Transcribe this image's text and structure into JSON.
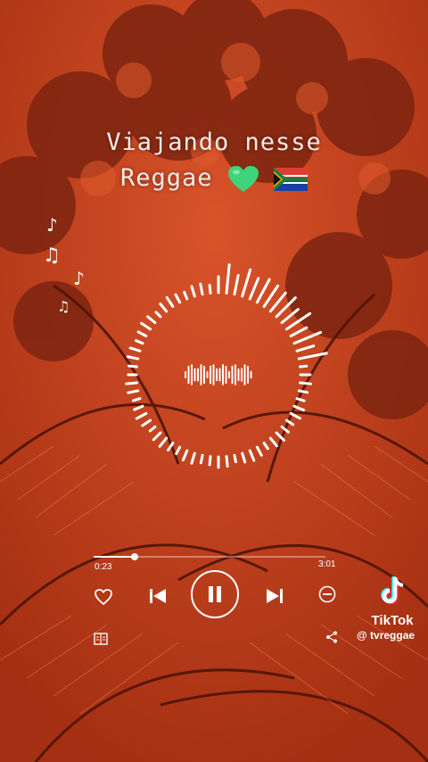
{
  "caption": {
    "line1": "Viajando nesse",
    "line2": "Reggae",
    "emojis": [
      "green-heart",
      "south-africa-flag"
    ]
  },
  "music_notes": [
    "♪",
    "♫",
    "♪",
    "♫"
  ],
  "player": {
    "elapsed": "0:23",
    "duration": "3:01",
    "progress": 0.13,
    "state": "playing",
    "buttons": [
      "heart-icon",
      "previous-icon",
      "pause-icon",
      "next-icon",
      "minus-circle-icon",
      "lyrics-icon",
      "share-icon"
    ]
  },
  "watermark": {
    "brand": "TikTok",
    "handle": "@ tvreggae"
  },
  "colors": {
    "background": "#c8401c",
    "foliage_dark": "#6a1d0c",
    "accent": "#ffffff"
  }
}
